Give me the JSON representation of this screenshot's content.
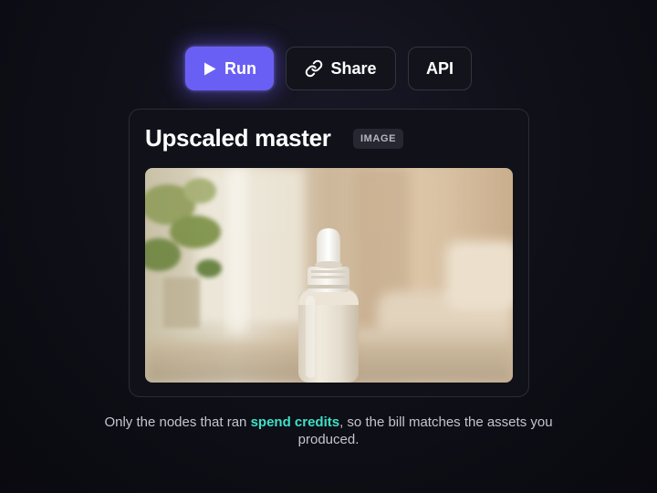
{
  "toolbar": {
    "run_label": "Run",
    "share_label": "Share",
    "api_label": "API"
  },
  "card": {
    "title": "Upscaled master",
    "badge": "IMAGE",
    "image": {
      "subject": "dropper-bottle-product-photo",
      "accent_color": "#6a5ff4"
    }
  },
  "caption": {
    "prefix": "Only the nodes that ran ",
    "highlight": "spend credits",
    "suffix": ", so the bill matches the assets you produced.",
    "highlight_color": "#3fe0c5"
  }
}
